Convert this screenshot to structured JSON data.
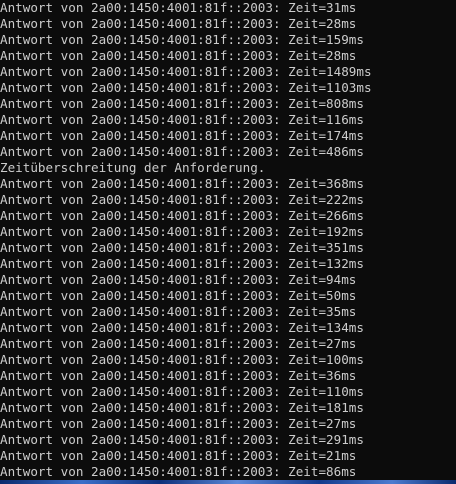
{
  "console": {
    "lines": [
      "Antwort von 2a00:1450:4001:81f::2003: Zeit=31ms",
      "Antwort von 2a00:1450:4001:81f::2003: Zeit=28ms",
      "Antwort von 2a00:1450:4001:81f::2003: Zeit=159ms",
      "Antwort von 2a00:1450:4001:81f::2003: Zeit=28ms",
      "Antwort von 2a00:1450:4001:81f::2003: Zeit=1489ms",
      "Antwort von 2a00:1450:4001:81f::2003: Zeit=1103ms",
      "Antwort von 2a00:1450:4001:81f::2003: Zeit=808ms",
      "Antwort von 2a00:1450:4001:81f::2003: Zeit=116ms",
      "Antwort von 2a00:1450:4001:81f::2003: Zeit=174ms",
      "Antwort von 2a00:1450:4001:81f::2003: Zeit=486ms",
      "Zeitüberschreitung der Anforderung.",
      "Antwort von 2a00:1450:4001:81f::2003: Zeit=368ms",
      "Antwort von 2a00:1450:4001:81f::2003: Zeit=222ms",
      "Antwort von 2a00:1450:4001:81f::2003: Zeit=266ms",
      "Antwort von 2a00:1450:4001:81f::2003: Zeit=192ms",
      "Antwort von 2a00:1450:4001:81f::2003: Zeit=351ms",
      "Antwort von 2a00:1450:4001:81f::2003: Zeit=132ms",
      "Antwort von 2a00:1450:4001:81f::2003: Zeit=94ms",
      "Antwort von 2a00:1450:4001:81f::2003: Zeit=50ms",
      "Antwort von 2a00:1450:4001:81f::2003: Zeit=35ms",
      "Antwort von 2a00:1450:4001:81f::2003: Zeit=134ms",
      "Antwort von 2a00:1450:4001:81f::2003: Zeit=27ms",
      "Antwort von 2a00:1450:4001:81f::2003: Zeit=100ms",
      "Antwort von 2a00:1450:4001:81f::2003: Zeit=36ms",
      "Antwort von 2a00:1450:4001:81f::2003: Zeit=110ms",
      "Antwort von 2a00:1450:4001:81f::2003: Zeit=181ms",
      "Antwort von 2a00:1450:4001:81f::2003: Zeit=27ms",
      "Antwort von 2a00:1450:4001:81f::2003: Zeit=291ms",
      "Antwort von 2a00:1450:4001:81f::2003: Zeit=21ms",
      "Antwort von 2a00:1450:4001:81f::2003: Zeit=86ms"
    ]
  },
  "colors": {
    "background": "#0c0c0c",
    "text": "#cccccc"
  }
}
